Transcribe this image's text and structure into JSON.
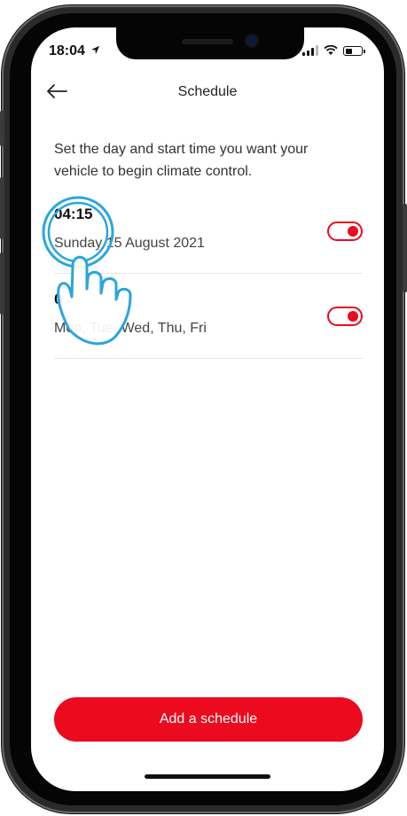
{
  "status_bar": {
    "time": "18:04",
    "location_icon": "location-arrow-icon",
    "signal_icon": "cellular-signal-icon",
    "wifi_icon": "wifi-icon",
    "battery_icon": "battery-icon",
    "battery_level": 0.45
  },
  "header": {
    "title": "Schedule",
    "back_icon": "arrow-left-icon"
  },
  "description": "Set the day and start time you want your vehicle to begin climate control.",
  "schedules": [
    {
      "time": "04:15",
      "days": "Sunday 15 August 2021",
      "enabled": true
    },
    {
      "time": "0",
      "days": "Mon, Tue, Wed, Thu, Fri",
      "enabled": true
    }
  ],
  "add_button_label": "Add a schedule",
  "overlay": {
    "hand_icon": "tap-hand-icon",
    "ring_icon": "tap-ring-icon"
  },
  "colors": {
    "accent": "#eb0a1e",
    "overlay": "#2aa5dc"
  }
}
